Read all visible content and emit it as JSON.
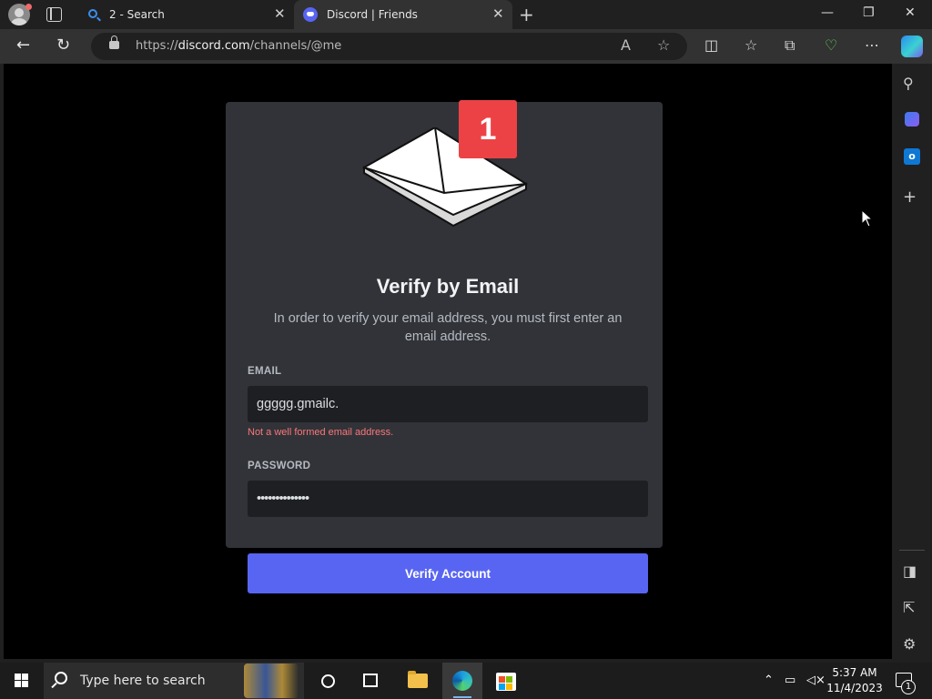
{
  "browser": {
    "tabs": [
      {
        "label": "2 - Search"
      },
      {
        "label": "Discord | Friends"
      }
    ],
    "address": {
      "url_prefix": "https://",
      "url_domain": "discord.com",
      "url_path": "/channels/@me"
    }
  },
  "modal": {
    "badge_count": "1",
    "title": "Verify by Email",
    "subtitle": "In order to verify your email address, you must first enter an email address.",
    "email_label": "EMAIL",
    "email_value": "ggggg.gmailc.",
    "email_error": "Not a well formed email address.",
    "password_label": "PASSWORD",
    "password_value": "••••••••••••••",
    "submit_label": "Verify Account"
  },
  "taskbar": {
    "search_placeholder": "Type here to search",
    "time": "5:37 AM",
    "date": "11/4/2023",
    "notification_count": "1"
  },
  "colors": {
    "accent": "#5865f2",
    "badge": "#ed4245",
    "error": "#fa777c",
    "modal_bg": "#313338",
    "input_bg": "#1e1f22"
  }
}
